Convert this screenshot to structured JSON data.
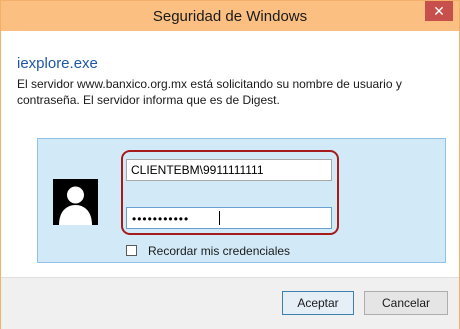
{
  "window": {
    "title": "Seguridad de Windows",
    "close_symbol": "✕"
  },
  "dialog": {
    "app_name": "iexplore.exe",
    "message": "El servidor www.banxico.org.mx está solicitando su nombre de usuario y contraseña. El servidor informa que es de Digest."
  },
  "credentials": {
    "avatar_icon": "user-avatar-icon",
    "username_value": "CLIENTEBM\\9911111111",
    "password_masked": "•••••••••••",
    "remember_label": "Recordar mis credenciales",
    "remember_checked": false
  },
  "buttons": {
    "accept_label": "Aceptar",
    "cancel_label": "Cancelar"
  },
  "colors": {
    "titlebar": "#fbbf81",
    "close_button": "#c7504c",
    "app_name": "#1f56a8",
    "credential_panel": "#d2eaf8",
    "highlight_outline": "#a61b1b"
  }
}
